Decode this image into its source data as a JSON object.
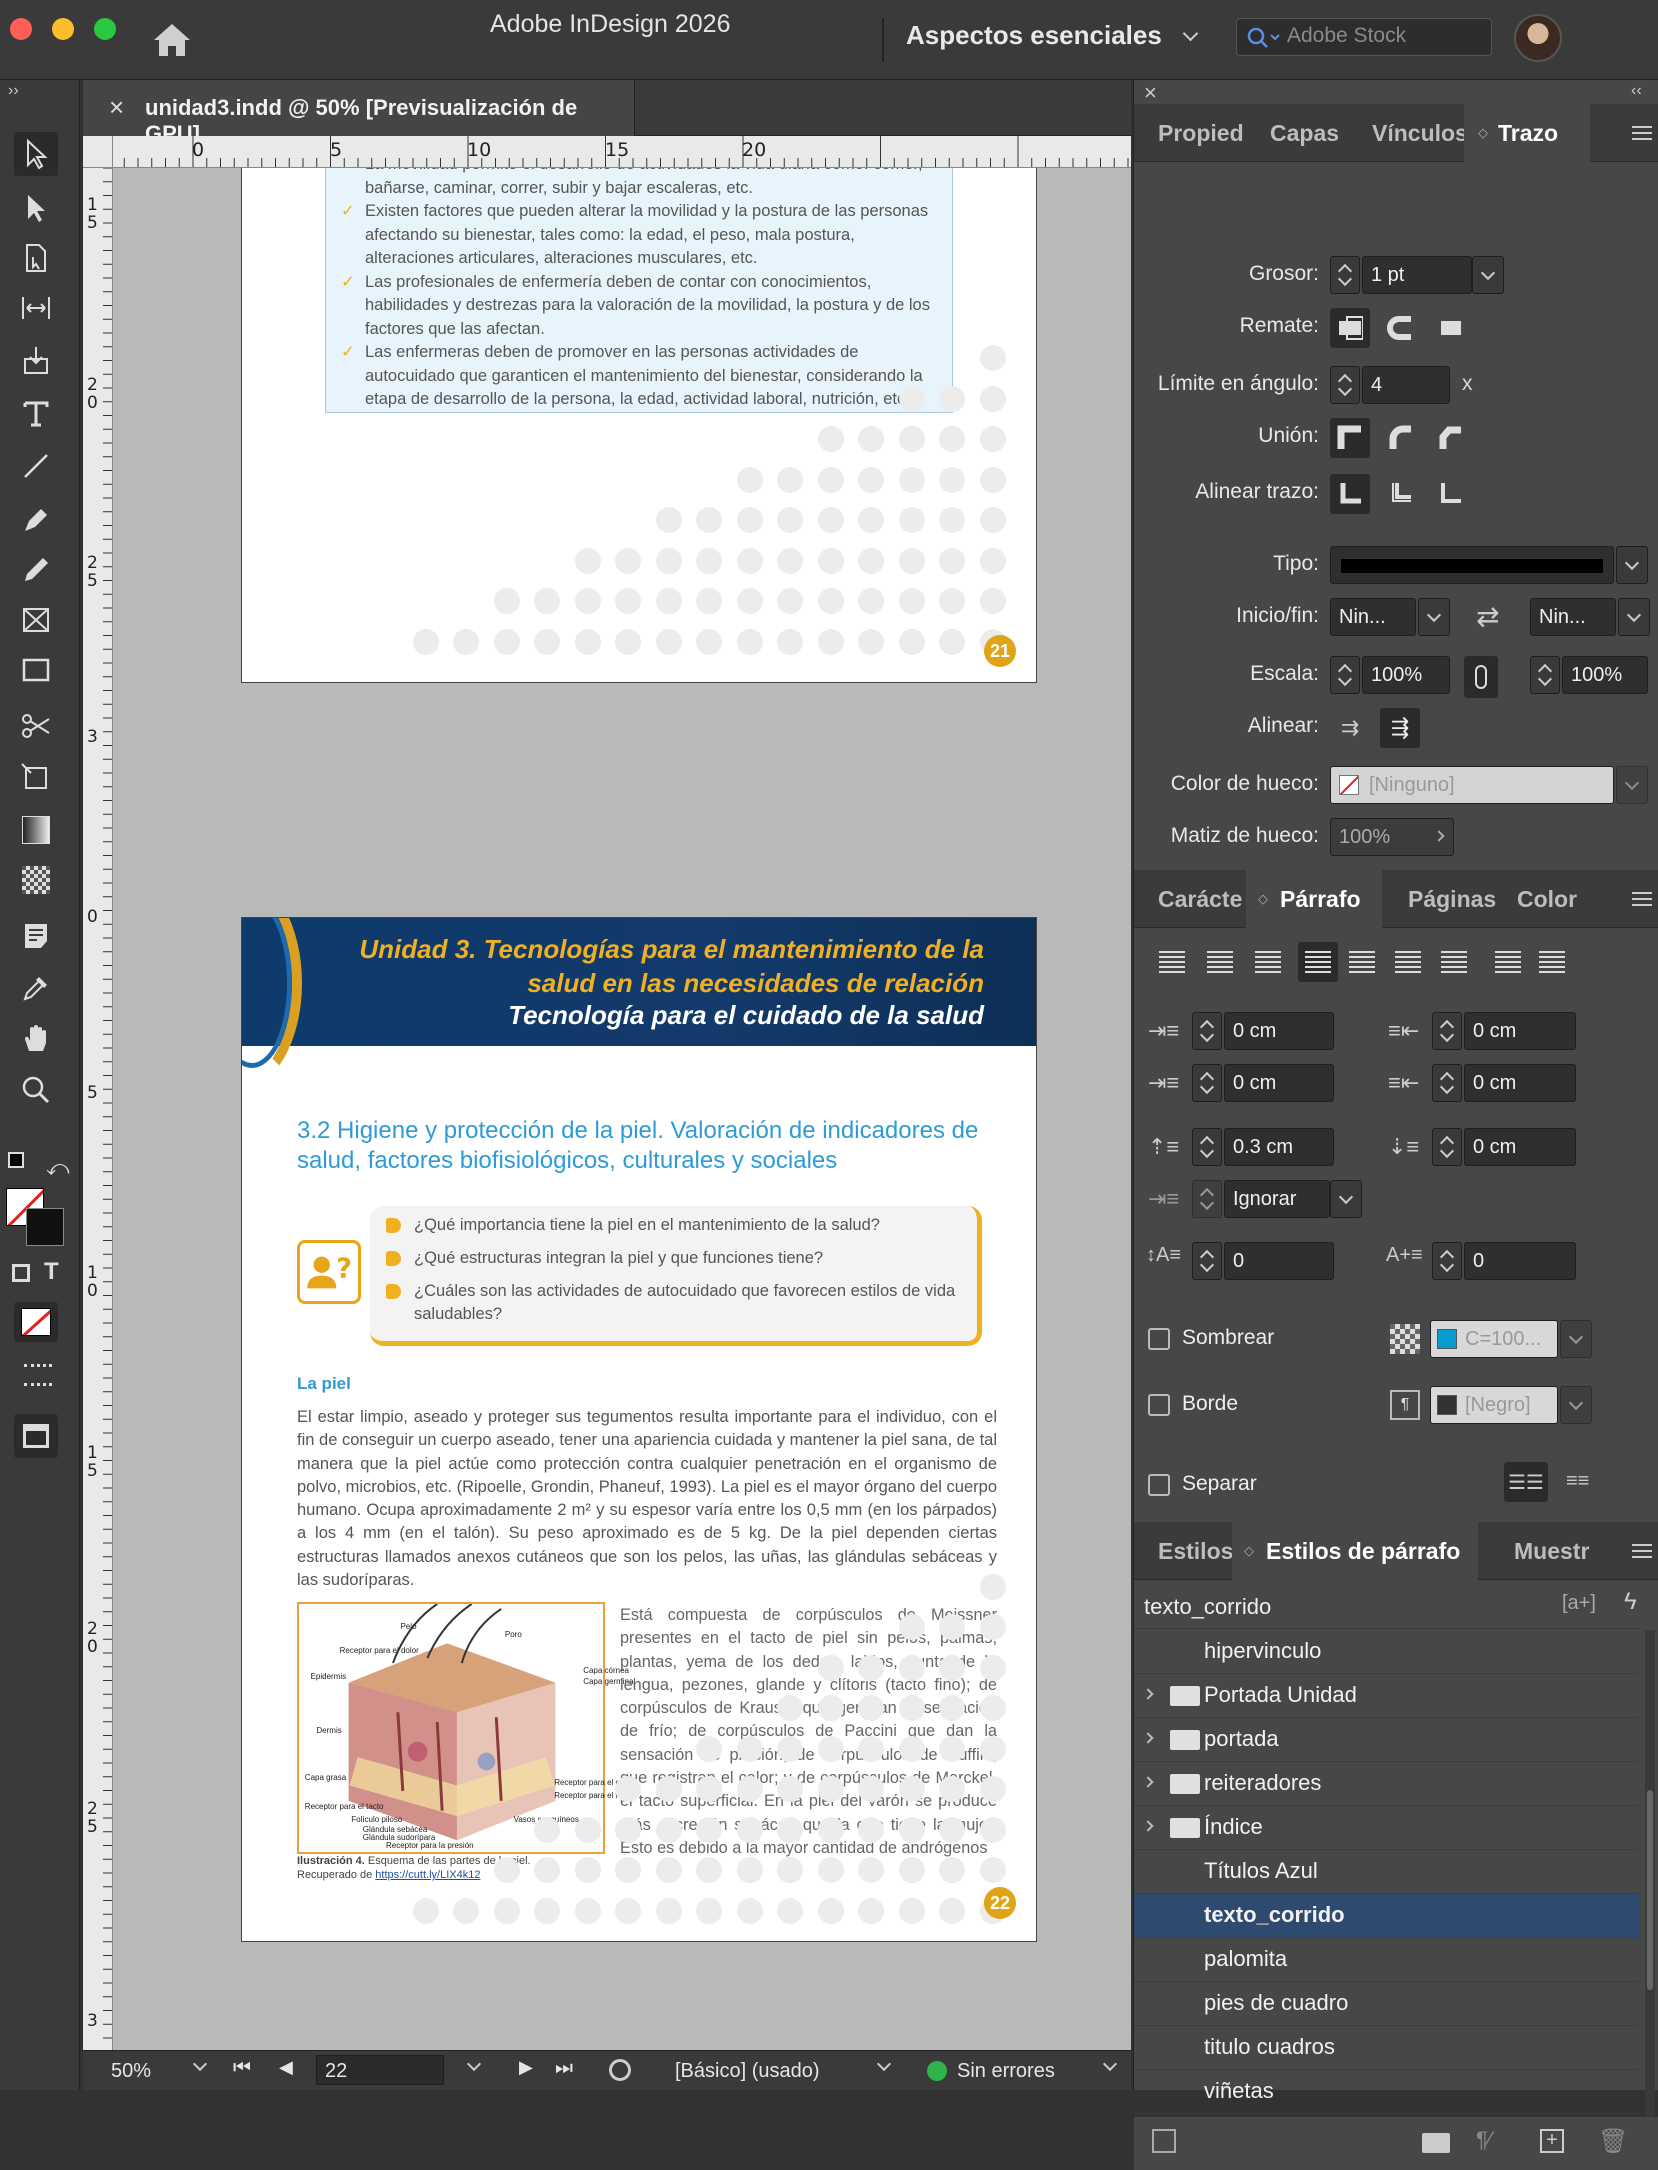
{
  "app": {
    "title": "Adobe InDesign 2026",
    "workspace": "Aspectos esenciales",
    "stock_placeholder": "Adobe Stock"
  },
  "document": {
    "tab_label": "unidad3.indd @ 50% [Previsualización de GPU]"
  },
  "ruler": {
    "h_ticks": [
      "0",
      "5",
      "10",
      "15",
      "20"
    ],
    "v_ticks": [
      "1\n5",
      "2\n0",
      "2\n5",
      "3",
      "0",
      "5",
      "1\n0",
      "1\n5",
      "2\n0",
      "2\n5",
      "3"
    ]
  },
  "page21": {
    "bullets": [
      "La movilidad permite el desarrollo de actividades la vida diaria como: comer, bañarse, caminar, correr, subir y bajar escaleras, etc.",
      "Existen factores que pueden alterar la movilidad y la postura de las personas afectando su bienestar, tales como: la edad, el peso, mala postura, alteraciones articulares, alteraciones musculares, etc.",
      "Las profesionales de enfermería deben de contar con conocimientos, habilidades y destrezas para la valoración de la movilidad, la postura y de los factores que las afectan.",
      "Las enfermeras deben de promover en las personas actividades de autocuidado que garanticen el mantenimiento del bienestar, considerando la etapa de desarrollo de la persona, la edad, actividad laboral, nutrición, etc."
    ],
    "page_number": "21"
  },
  "page22": {
    "header_unit": "Unidad 3. Tecnologías para el mantenimiento de la salud en las necesidades de relación",
    "header_sub": "Tecnología para el cuidado de la salud",
    "section_title": "3.2  Higiene y protección de la piel. Valoración de indicadores de salud, factores biofisiológicos, culturales y sociales",
    "questions": [
      "¿Qué importancia tiene la piel en el mantenimiento de la salud?",
      "¿Qué estructuras integran la piel y que funciones tiene?",
      "¿Cuáles son las actividades de autocuidado que favorecen estilos de vida saludables?"
    ],
    "subhead": "La piel",
    "body": "El estar limpio, aseado y proteger sus tegumentos resulta importante para el individuo, con el fin de conseguir un cuerpo aseado, tener una apariencia cuidada y mantener la piel sana, de tal manera que la piel actúe como protección contra cualquier penetración en el organismo de polvo, microbios, etc. (Ripoelle, Grondin, Phaneuf, 1993). La piel es el mayor órgano del cuerpo humano. Ocupa aproximadamente 2 m² y su espesor varía entre los 0,5 mm (en los párpados) a los 4 mm (en el talón). Su peso aproximado es de 5 kg. De la piel dependen ciertas estructuras llamados anexos cutáneos que son los pelos, las uñas, las glándulas sebáceas y las sudoríparas.",
    "side_text": "Está compuesta de corpúsculos de Meissner presentes en el tacto de piel sin pelos, palmas, plantas, yema de los dedos, labios, punta de la lengua, pezones, glande y clítoris (tacto fino); de corpúsculos de Krause, que generan la sensación de frío; de corpúsculos de Paccini que dan la sensación de presión; de corpúsculos de Ruffini, que registran el calor; y de corpúsculos de Merckel, el tacto superficial. En la piel del varón se produce más secreción sebácea que la que tiene la mujer. Esto es debido a la mayor cantidad de andrógenos",
    "figure_labels": [
      "Pelo",
      "Poro",
      "Receptor para el dolor",
      "Epidermis",
      "Capa córnea",
      "Capa germinal",
      "Dermis",
      "Capa grasa",
      "Receptor para el calor",
      "Receptor para el frío",
      "Receptor para el tacto",
      "Folículo piloso",
      "Glándula sebácea",
      "Glándula sudorípara",
      "Vasos sanguíneos",
      "Receptor para la presión"
    ],
    "caption_bold": "Ilustración 4.",
    "caption_text": " Esquema de las partes de la piel.",
    "caption_recovered": "Recuperado de ",
    "caption_link": "https://cutt.ly/LIX4k12",
    "page_number": "22"
  },
  "status": {
    "zoom": "50%",
    "page": "22",
    "style": "[Básico] (usado)",
    "errors": "Sin errores"
  },
  "panel_top": {
    "tabs": [
      "Propied",
      "Capas",
      "Vínculos",
      "Trazo"
    ],
    "grosor_label": "Grosor:",
    "grosor": "1 pt",
    "remate_label": "Remate:",
    "limite_label": "Límite en ángulo:",
    "limite": "4",
    "limite_x": "x",
    "union_label": "Unión:",
    "alinear_trazo_label": "Alinear trazo:",
    "tipo_label": "Tipo:",
    "iniciofin_label": "Inicio/fin:",
    "inicio": "Nin...",
    "fin": "Nin...",
    "escala_label": "Escala:",
    "escala1": "100%",
    "escala2": "100%",
    "alinear_label": "Alinear:",
    "color_hueco_label": "Color de hueco:",
    "color_hueco": "[Ninguno]",
    "matiz_hueco_label": "Matiz de hueco:",
    "matiz_hueco": "100%"
  },
  "panel_mid": {
    "tabs": [
      "Carácte",
      "Párrafo",
      "Páginas",
      "Color"
    ],
    "indent_left": "0 cm",
    "indent_right": "0 cm",
    "first_line": "0 cm",
    "last_line": "0 cm",
    "space_before": "0.3 cm",
    "space_after": "0 cm",
    "grid": "Ignorar",
    "drop_lines": "0",
    "drop_chars": "0",
    "sombrear_label": "Sombrear",
    "sombrear_color": "C=100...",
    "borde_label": "Borde",
    "borde_color": "[Negro]",
    "separar_label": "Separar"
  },
  "panel_bottom": {
    "tabs": [
      "Estilos",
      "Estilos de párrafo",
      "Muestr"
    ],
    "current": "texto_corrido",
    "styles": [
      {
        "name": "hipervinculo",
        "folder": false
      },
      {
        "name": "Portada Unidad",
        "folder": true
      },
      {
        "name": "portada",
        "folder": true
      },
      {
        "name": "reiteradores",
        "folder": true
      },
      {
        "name": "Índice",
        "folder": true
      },
      {
        "name": "Títulos Azul",
        "folder": false
      },
      {
        "name": "texto_corrido",
        "folder": false,
        "selected": true
      },
      {
        "name": "palomita",
        "folder": false
      },
      {
        "name": "pies de cuadro",
        "folder": false
      },
      {
        "name": "titulo cuadros",
        "folder": false
      },
      {
        "name": "viñetas",
        "folder": false
      }
    ]
  },
  "colors": {
    "accent_blue": "#2e9bd5",
    "header_navy": "#123a6a",
    "gold": "#e0a418",
    "selection": "#2e4a6e"
  }
}
